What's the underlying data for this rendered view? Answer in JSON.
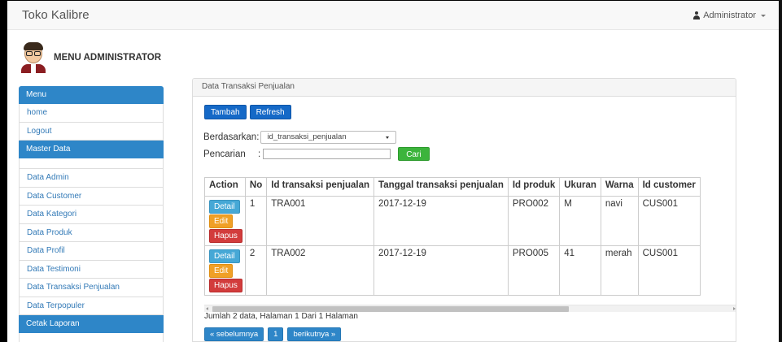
{
  "navbar": {
    "brand": "Toko Kalibre",
    "user": "Administrator"
  },
  "admin": {
    "title": "MENU ADMINISTRATOR"
  },
  "sidebar": {
    "menu_header": "Menu",
    "menu_items": [
      "home",
      "Logout"
    ],
    "master_header": "Master Data",
    "master_items": [
      "Data Admin",
      "Data Customer",
      "Data Kategori",
      "Data Produk",
      "Data Profil",
      "Data Testimoni",
      "Data Transaksi Penjualan",
      "Data Terpopuler"
    ],
    "report_header": "Cetak Laporan"
  },
  "panel": {
    "title": "Data Transaksi Penjualan",
    "add_label": "Tambah",
    "refresh_label": "Refresh",
    "filter_label": "Berdasarkan",
    "filter_colon": ":",
    "filter_value": "id_transaksi_penjualan",
    "search_label": "Pencarian",
    "search_colon": ":",
    "search_value": "",
    "search_button": "Cari"
  },
  "table": {
    "headers": [
      "Action",
      "No",
      "Id transaksi penjualan",
      "Tanggal transaksi penjualan",
      "Id produk",
      "Ukuran",
      "Warna",
      "Id customer"
    ],
    "action_labels": {
      "detail": "Detail",
      "edit": "Edit",
      "delete": "Hapus"
    },
    "rows": [
      {
        "no": "1",
        "id": "TRA001",
        "date": "2017-12-19",
        "product": "PRO002",
        "size": "M",
        "color": "navi",
        "customer": "CUS001"
      },
      {
        "no": "2",
        "id": "TRA002",
        "date": "2017-12-19",
        "product": "PRO005",
        "size": "41",
        "color": "merah",
        "customer": "CUS001"
      }
    ]
  },
  "summary": "Jumlah 2 data, Halaman 1 Dari 1 Halaman",
  "pager": {
    "prev": "« sebelumnya",
    "page": "1",
    "next": "berikutnya »"
  },
  "colors": {
    "primary": "#1569c7",
    "success": "#3cb43c",
    "info": "#46a8d6",
    "warning": "#f0a026",
    "danger": "#d23c3c",
    "sidebar_header": "#2e86c8"
  }
}
